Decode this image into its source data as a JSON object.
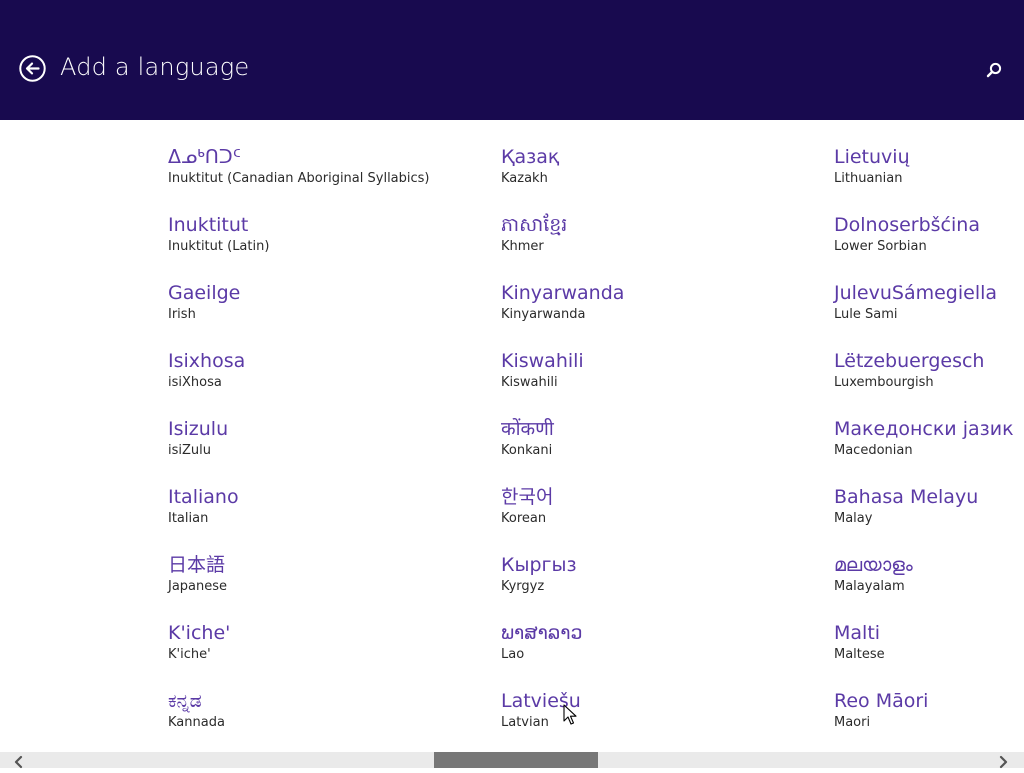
{
  "header": {
    "title": "Add a language",
    "back_icon": "back-arrow-circle-icon",
    "search_icon": "search-icon",
    "background_color": "#180a4f"
  },
  "colors": {
    "native_name": "#5b3aa6",
    "english_name": "#2b2b2b"
  },
  "languages": [
    [
      {
        "native": "ᐃᓄᒃᑎᑐᑦ",
        "english": "Inuktitut (Canadian Aboriginal Syllabics)"
      },
      {
        "native": "Inuktitut",
        "english": "Inuktitut (Latin)"
      },
      {
        "native": "Gaeilge",
        "english": "Irish"
      },
      {
        "native": "Isixhosa",
        "english": "isiXhosa"
      },
      {
        "native": "Isizulu",
        "english": "isiZulu"
      },
      {
        "native": "Italiano",
        "english": "Italian"
      },
      {
        "native": "日本語",
        "english": "Japanese"
      },
      {
        "native": "K'iche'",
        "english": "K'iche'"
      },
      {
        "native": "ಕನ್ನಡ",
        "english": "Kannada"
      }
    ],
    [
      {
        "native": "Қазақ",
        "english": "Kazakh"
      },
      {
        "native": "ភាសាខ្មែរ",
        "english": "Khmer"
      },
      {
        "native": "Kinyarwanda",
        "english": "Kinyarwanda"
      },
      {
        "native": "Kiswahili",
        "english": "Kiswahili"
      },
      {
        "native": "कोंकणी",
        "english": "Konkani"
      },
      {
        "native": "한국어",
        "english": "Korean"
      },
      {
        "native": "Кыргыз",
        "english": "Kyrgyz"
      },
      {
        "native": "ພາສາລາວ",
        "english": "Lao"
      },
      {
        "native": "Latviešu",
        "english": "Latvian"
      }
    ],
    [
      {
        "native": "Lietuvių",
        "english": "Lithuanian"
      },
      {
        "native": "Dolnoserbšćina",
        "english": "Lower Sorbian"
      },
      {
        "native": "JulevuSámegiella",
        "english": "Lule Sami"
      },
      {
        "native": "Lëtzebuergesch",
        "english": "Luxembourgish"
      },
      {
        "native": "Македонски јазик",
        "english": "Macedonian"
      },
      {
        "native": "Bahasa Melayu",
        "english": "Malay"
      },
      {
        "native": "മലയാളം",
        "english": "Malayalam"
      },
      {
        "native": "Malti",
        "english": "Maltese"
      },
      {
        "native": "Reo Māori",
        "english": "Maori"
      }
    ]
  ],
  "scrollbar": {
    "left_icon": "chevron-left-icon",
    "right_icon": "chevron-right-icon"
  }
}
